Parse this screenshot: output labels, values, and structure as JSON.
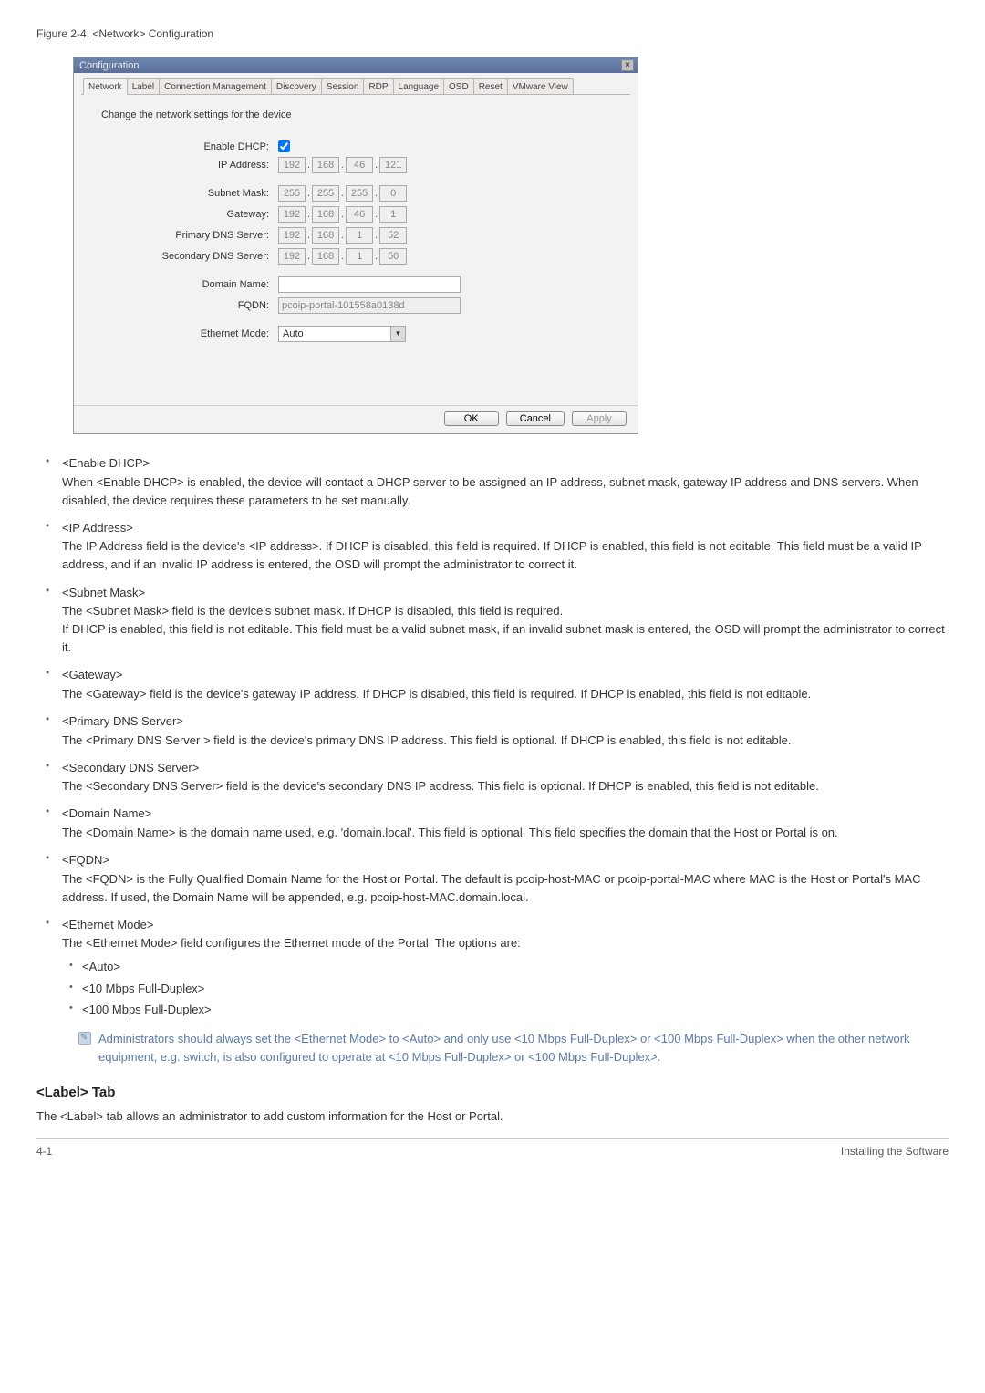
{
  "figure_caption": "Figure 2-4: <Network> Configuration",
  "dialog": {
    "title": "Configuration",
    "tabs": [
      "Network",
      "Label",
      "Connection Management",
      "Discovery",
      "Session",
      "RDP",
      "Language",
      "OSD",
      "Reset",
      "VMware View"
    ],
    "instruction": "Change the network settings for the device",
    "labels": {
      "enable_dhcp": "Enable DHCP:",
      "ip_address": "IP Address:",
      "subnet_mask": "Subnet Mask:",
      "gateway": "Gateway:",
      "primary_dns": "Primary DNS Server:",
      "secondary_dns": "Secondary DNS Server:",
      "domain_name": "Domain Name:",
      "fqdn": "FQDN:",
      "ethernet_mode": "Ethernet Mode:"
    },
    "values": {
      "ip": [
        "192",
        "168",
        "46",
        "121"
      ],
      "subnet": [
        "255",
        "255",
        "255",
        "0"
      ],
      "gateway": [
        "192",
        "168",
        "46",
        "1"
      ],
      "pdns": [
        "192",
        "168",
        "1",
        "52"
      ],
      "sdns": [
        "192",
        "168",
        "1",
        "50"
      ],
      "domain_name": "",
      "fqdn": "pcoip-portal-101558a0138d",
      "ethernet_mode": "Auto"
    },
    "buttons": {
      "ok": "OK",
      "cancel": "Cancel",
      "apply": "Apply"
    }
  },
  "fields": [
    {
      "name": "<Enable DHCP>",
      "desc": "When <Enable DHCP> is enabled, the device will contact a DHCP server to be assigned an IP address, subnet mask, gateway IP address and DNS servers. When disabled, the device requires these parameters to be set manually."
    },
    {
      "name": "<IP Address>",
      "desc": "The IP Address field is the device's <IP address>. If DHCP is disabled, this field is required. If DHCP is enabled, this field is not editable. This field must be a valid IP address, and if an invalid IP address is entered, the OSD will prompt the administrator to correct it."
    },
    {
      "name": "<Subnet Mask>",
      "desc": "The <Subnet Mask> field is the device's subnet mask. If DHCP is disabled, this field is required.\n If DHCP is enabled, this field is not editable. This field must be a valid subnet mask, if an invalid subnet mask is entered, the OSD will prompt the administrator to correct it."
    },
    {
      "name": "<Gateway>",
      "desc": "The <Gateway> field is the device's gateway IP address. If DHCP is disabled, this field is required. If DHCP is enabled, this field is not editable."
    },
    {
      "name": "<Primary DNS Server>",
      "desc": "The <Primary DNS Server > field is the device's primary DNS IP address. This field is optional. If DHCP is enabled, this field is not editable."
    },
    {
      "name": "<Secondary DNS Server>",
      "desc": "The <Secondary DNS Server> field is the device's secondary DNS IP address. This field is optional. If DHCP is enabled, this field is not editable."
    },
    {
      "name": "<Domain Name>",
      "desc": "The <Domain Name> is the domain name used, e.g. 'domain.local'. This field is optional. This field specifies the domain that the Host or Portal is on."
    },
    {
      "name": "<FQDN>",
      "desc": "The <FQDN> is the Fully Qualified Domain Name for the Host or Portal.  The default is pcoip-host-MAC or pcoip-portal-MAC where MAC is the Host or Portal's MAC address.  If used, the Domain Name will be appended, e.g. pcoip-host-MAC.domain.local."
    },
    {
      "name": "<Ethernet Mode>",
      "desc": "The <Ethernet Mode> field configures the Ethernet mode of the Portal. The options are:",
      "sub": [
        "<Auto>",
        "<10 Mbps Full-Duplex>",
        "<100 Mbps Full-Duplex>"
      ],
      "note": "Administrators should always set the <Ethernet Mode> to <Auto> and only use <10 Mbps Full-Duplex> or <100 Mbps Full-Duplex> when the other network equipment, e.g. switch, is also configured to operate at <10 Mbps Full-Duplex> or <100 Mbps Full-Duplex>."
    }
  ],
  "label_tab": {
    "heading": "<Label> Tab",
    "para": "The <Label> tab allows an administrator to add custom information for the Host or Portal."
  },
  "footer": {
    "left": "4-1",
    "right": "Installing the Software"
  }
}
